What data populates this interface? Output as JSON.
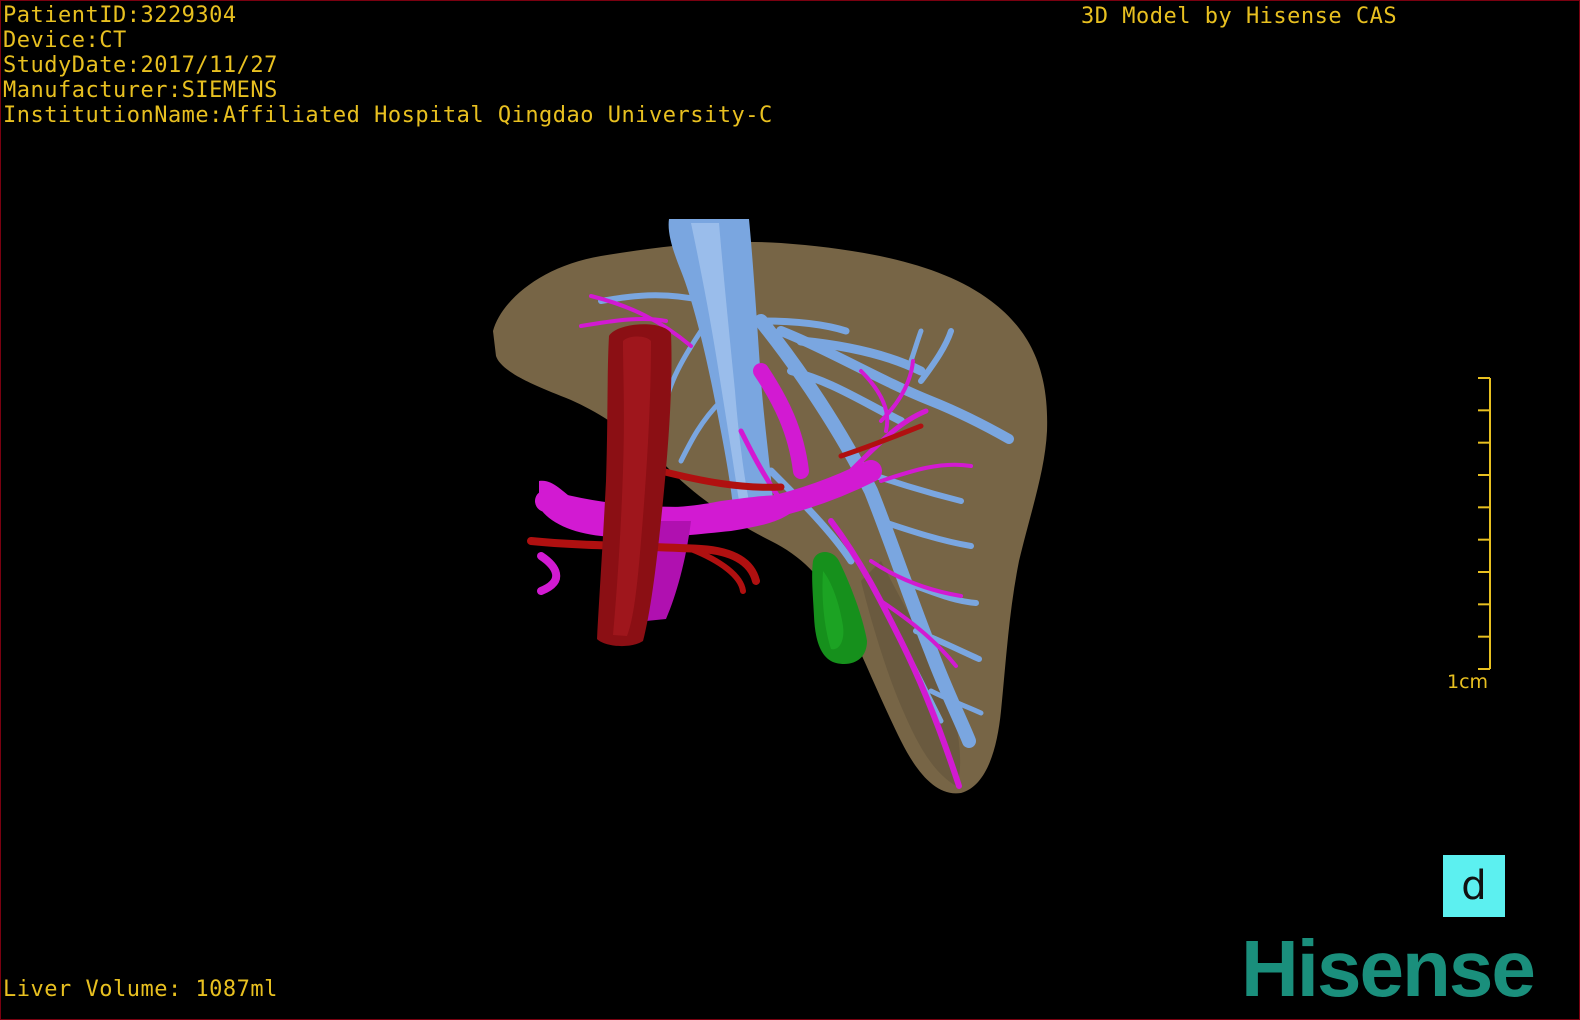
{
  "viewer": {
    "patient_info": [
      "PatientID:3229304",
      "Device:CT",
      "StudyDate:2017/11/27",
      "Manufacturer:SIEMENS",
      "InstitutionName:Affiliated Hospital Qingdao University-C"
    ],
    "watermark": "3D Model by Hisense CAS",
    "liver_volume": "Liver Volume: 1087ml",
    "scale_label": "1cm",
    "orientation_label": "d",
    "logo": "Hisense"
  },
  "colors": {
    "overlay_text": "#e8c020",
    "liver": "#7d6a4a",
    "hepatic_vein": "#7aa6e0",
    "portal_vein": "#d21ad2",
    "aorta": "#8b0f14",
    "hepatic_artery": "#b01010",
    "gallbladder": "#16901c",
    "orientation_button": "#5cf0f0",
    "logo": "#1a8f7c"
  },
  "structures": [
    "liver",
    "hepatic-vein",
    "portal-vein",
    "aorta",
    "hepatic-artery",
    "gallbladder"
  ]
}
